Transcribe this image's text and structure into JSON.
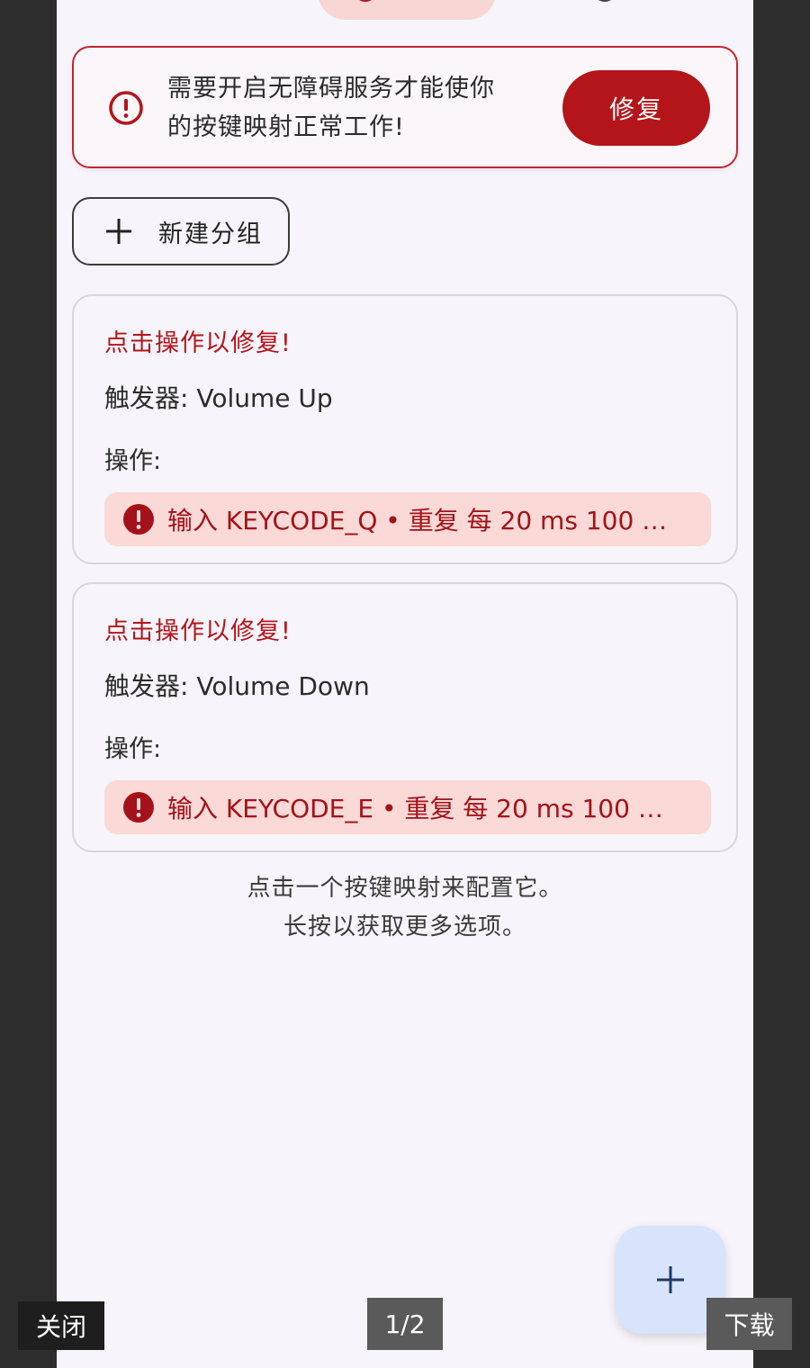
{
  "banner": {
    "message_line1": "需要开启无障碍服务才能使你",
    "message_line2": "的按键映射正常工作!",
    "fix_label": "修复"
  },
  "new_group": {
    "label": "新建分组"
  },
  "mappings": [
    {
      "fix_hint": "点击操作以修复!",
      "trigger": "触发器: Volume Up",
      "actions_label": "操作:",
      "action_text": "输入 KEYCODE_Q • 重复 每 20 ms 100 …"
    },
    {
      "fix_hint": "点击操作以修复!",
      "trigger": "触发器: Volume Down",
      "actions_label": "操作:",
      "action_text": "输入 KEYCODE_E • 重复 每 20 ms 100 …"
    }
  ],
  "hint": {
    "line1": "点击一个按键映射来配置它。",
    "line2": "长按以获取更多选项。"
  },
  "viewer": {
    "close_label": "关闭",
    "page_indicator": "1/2",
    "download_label": "下载"
  },
  "colors": {
    "accent_red": "#b3151b",
    "chip_bg": "#fad9d6",
    "fab_bg": "#d8e4fb"
  },
  "icons": {
    "banner": "alert-circle-outline-icon",
    "action": "alert-circle-filled-icon",
    "new_group": "plus-icon",
    "fab": "plus-icon"
  }
}
